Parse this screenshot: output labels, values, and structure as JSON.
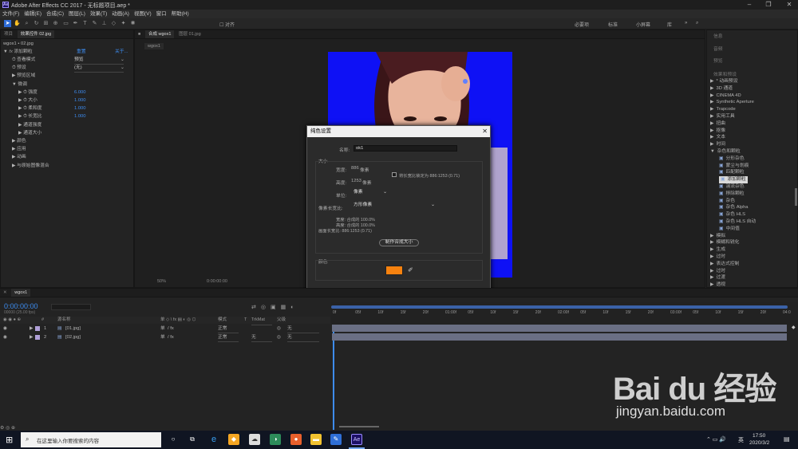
{
  "window": {
    "title": "Adobe After Effects CC 2017 - 无标题项目.aep *",
    "app_icon": "Ae"
  },
  "menu": [
    "文件(F)",
    "编辑(E)",
    "合成(C)",
    "图层(L)",
    "效果(T)",
    "动画(A)",
    "视图(V)",
    "窗口",
    "帮助(H)"
  ],
  "toolbar": {
    "snap_label": "对齐",
    "workspaces": [
      "必要项",
      "标准",
      "小屏幕",
      "库"
    ]
  },
  "effect_controls": {
    "tabs": [
      "项目",
      "效果控件 02.jpg"
    ],
    "layer_path": "wgox1 • 02.jpg",
    "effect_name": "添加颗粒",
    "reset": "重置",
    "about": "关于...",
    "rows": [
      {
        "label": "查看模式",
        "value": "预览"
      },
      {
        "label": "预设",
        "value": "(无)"
      },
      {
        "label": "预览区域",
        "value": ""
      },
      {
        "label": "微调",
        "value": ""
      },
      {
        "label": "强度",
        "value": "6.000"
      },
      {
        "label": "大小",
        "value": "1.000"
      },
      {
        "label": "柔和度",
        "value": "1.000"
      },
      {
        "label": "长宽比",
        "value": "1.000"
      },
      {
        "label": "通道强度",
        "value": ""
      },
      {
        "label": "通道大小",
        "value": ""
      },
      {
        "label": "颜色",
        "value": ""
      },
      {
        "label": "应用",
        "value": ""
      },
      {
        "label": "动画",
        "value": ""
      },
      {
        "label": "与原始图像混合",
        "value": ""
      }
    ]
  },
  "composition": {
    "tabs": [
      "合成 wgox1",
      "图层 01.jpg"
    ],
    "subtab": "wgox1",
    "zoom": "50%",
    "timecode": "0:00:00:00"
  },
  "dialog": {
    "title": "纯色设置",
    "name_label": "名称:",
    "name_value": "ok1",
    "size_heading": "大小",
    "width_label": "宽度:",
    "width_value": "886",
    "height_label": "高度:",
    "height_value": "1253",
    "px_unit": "像素",
    "lock_label": "将长宽比锁定为 886:1253 (0.71)",
    "units_label": "单位:",
    "units_value": "像素",
    "par_label": "像素长宽比:",
    "par_value": "方形像素",
    "info_width": "宽度: 合成的 100.0%",
    "info_height": "高度: 合成的 100.0%",
    "info_frame": "画面长宽比: 886:1253 (0.71)",
    "make_comp_size": "制作合成大小",
    "color_heading": "颜色",
    "swatch_color": "#f7820f",
    "preview_label": "预览",
    "ok": "确定",
    "cancel": "取消"
  },
  "effects_presets": {
    "top_tabs": [
      "信息",
      "音频",
      "预览",
      "效果和预设"
    ],
    "items": [
      {
        "text": "* 动画预设",
        "indent": 0,
        "arrow": "▶"
      },
      {
        "text": "3D 通道",
        "indent": 0,
        "arrow": "▶"
      },
      {
        "text": "CINEMA 4D",
        "indent": 0,
        "arrow": "▶"
      },
      {
        "text": "Synthetic Aperture",
        "indent": 0,
        "arrow": "▶"
      },
      {
        "text": "Trapcode",
        "indent": 0,
        "arrow": "▶"
      },
      {
        "text": "实用工具",
        "indent": 0,
        "arrow": "▶"
      },
      {
        "text": "扭曲",
        "indent": 0,
        "arrow": "▶"
      },
      {
        "text": "抠像",
        "indent": 0,
        "arrow": "▶"
      },
      {
        "text": "文本",
        "indent": 0,
        "arrow": "▶"
      },
      {
        "text": "时间",
        "indent": 0,
        "arrow": "▶"
      },
      {
        "text": "杂色和颗粒",
        "indent": 0,
        "arrow": "▼"
      },
      {
        "text": "分形杂色",
        "indent": 1,
        "arrow": ""
      },
      {
        "text": "蒙尘与划痕",
        "indent": 1,
        "arrow": ""
      },
      {
        "text": "匹配颗粒",
        "indent": 1,
        "arrow": ""
      },
      {
        "text": "添加颗粒",
        "indent": 1,
        "arrow": "",
        "selected": true
      },
      {
        "text": "湍流杂色",
        "indent": 1,
        "arrow": ""
      },
      {
        "text": "移除颗粒",
        "indent": 1,
        "arrow": ""
      },
      {
        "text": "杂色",
        "indent": 1,
        "arrow": ""
      },
      {
        "text": "杂色 Alpha",
        "indent": 1,
        "arrow": ""
      },
      {
        "text": "杂色 HLS",
        "indent": 1,
        "arrow": ""
      },
      {
        "text": "杂色 HLS 自动",
        "indent": 1,
        "arrow": ""
      },
      {
        "text": "中间值",
        "indent": 1,
        "arrow": ""
      },
      {
        "text": "模拟",
        "indent": 0,
        "arrow": "▶"
      },
      {
        "text": "模糊和锐化",
        "indent": 0,
        "arrow": "▶"
      },
      {
        "text": "生成",
        "indent": 0,
        "arrow": "▶"
      },
      {
        "text": "过时",
        "indent": 0,
        "arrow": "▶"
      },
      {
        "text": "表达式控制",
        "indent": 0,
        "arrow": "▶"
      },
      {
        "text": "过时",
        "indent": 0,
        "arrow": "▶"
      },
      {
        "text": "过渡",
        "indent": 0,
        "arrow": "▶"
      },
      {
        "text": "透视",
        "indent": 0,
        "arrow": "▶"
      }
    ]
  },
  "timeline": {
    "tab": "wgox1",
    "timecode": "0:00:00:00",
    "fps": "00000 (25.00 fps)",
    "headers": {
      "source": "源名称",
      "mode": "模式",
      "t": "T",
      "trkmat": "TrkMat",
      "parent": "父级"
    },
    "layers": [
      {
        "num": "1",
        "name": "[01.jpg]",
        "mode": "正常",
        "trkmat": "",
        "parent": "无"
      },
      {
        "num": "2",
        "name": "[02.jpg]",
        "mode": "正常",
        "trkmat": "无",
        "parent": "无"
      }
    ],
    "ruler": [
      "0f",
      "05f",
      "10f",
      "15f",
      "20f",
      "01:00f",
      "05f",
      "10f",
      "15f",
      "20f",
      "02:00f",
      "05f",
      "10f",
      "15f",
      "20f",
      "03:00f",
      "05f",
      "10f",
      "15f",
      "20f",
      "04:0"
    ]
  },
  "taskbar": {
    "search_placeholder": "在这里输入你要搜索的内容",
    "ime": "英",
    "time": "17:50",
    "date": "2020/3/2"
  },
  "watermark": {
    "brand": "Bai du 经验",
    "url": "jingyan.baidu.com"
  }
}
